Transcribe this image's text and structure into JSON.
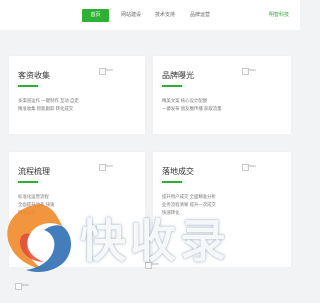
{
  "nav": {
    "items": [
      {
        "label": "首页",
        "active": true
      },
      {
        "label": "网站建设",
        "active": false
      },
      {
        "label": "技术支持",
        "active": false
      },
      {
        "label": "品牌运营",
        "active": false
      }
    ],
    "right_link": "明智科技"
  },
  "cards": [
    {
      "title": "客资收集",
      "lines": [
        "多渠道运作 一键制作 互动 自定",
        "精准收集 智能跟踪 转化成交"
      ],
      "image_alt": "icon"
    },
    {
      "title": "品牌曝光",
      "lines": [
        "精美文案 核心设计配图",
        "一键发布 朋友圈传播 获取流量"
      ],
      "image_alt": "icon"
    },
    {
      "title": "流程梳理",
      "lines": [
        "标准化运营流程",
        "全面提升效率 快速",
        "精准高效"
      ],
      "image_alt": "icon"
    },
    {
      "title": "落地成交",
      "lines": [
        "提升用户成交 全面精准分析",
        "业务流程清晰 提升一次成交",
        "快速转化"
      ],
      "image_alt": "icon"
    }
  ],
  "bottom_images": [
    {
      "alt": "icon"
    },
    {
      "alt": "icon"
    }
  ],
  "watermark": {
    "text": "快收录",
    "colors": {
      "orange": "#f08a2a",
      "blue": "#2f6fb5",
      "red": "#e24a3a"
    }
  },
  "colors": {
    "accent": "#2eb034",
    "background": "#f2f3f5"
  }
}
